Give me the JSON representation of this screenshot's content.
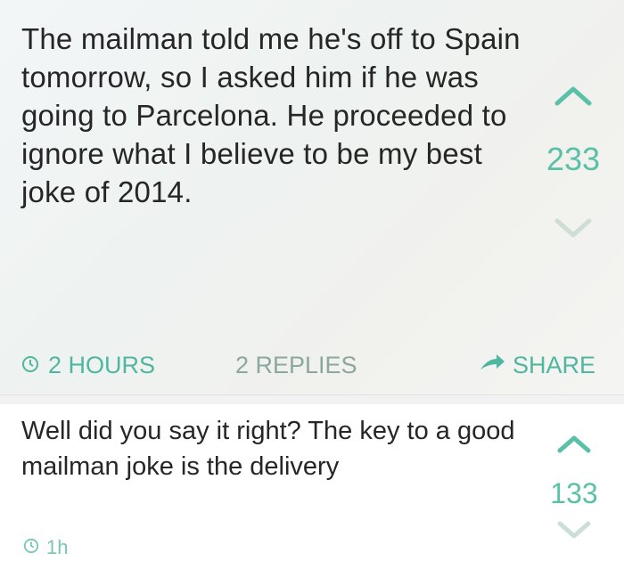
{
  "post": {
    "text": "The mailman told me he's off to Spain tomorrow, so I asked him if he was going to Parcelona. He proceeded to ignore what I believe to be my best joke of 2014.",
    "votes": "233",
    "time": "2 HOURS",
    "replies": "2 REPLIES",
    "share": "SHARE"
  },
  "reply": {
    "text": "Well did you say it right? The key to a good mailman joke is the delivery",
    "votes": "133",
    "time": "1h"
  },
  "colors": {
    "accent": "#4fb7a0",
    "text": "#262626"
  },
  "icons": [
    "upvote-chevron-icon",
    "downvote-chevron-icon",
    "clock-icon",
    "share-arrow-icon"
  ]
}
